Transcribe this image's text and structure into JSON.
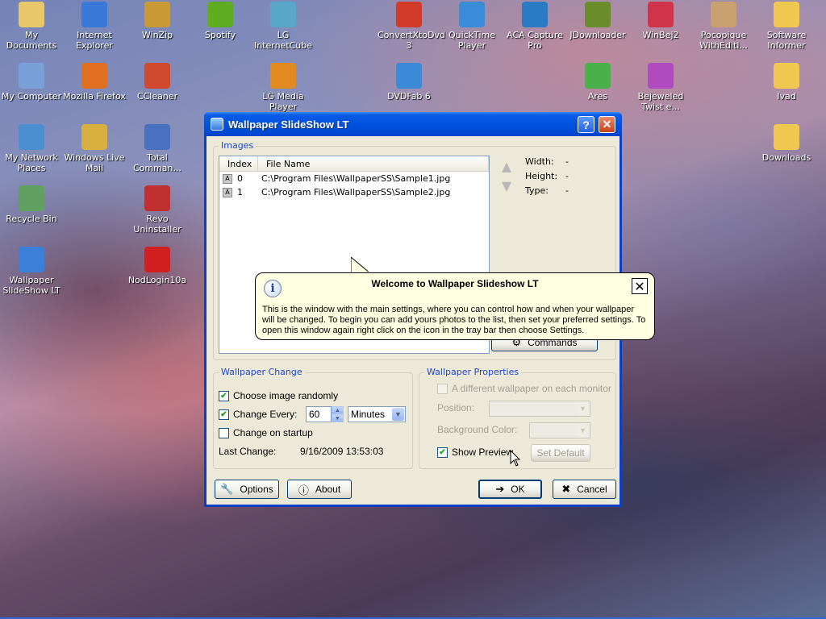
{
  "desktop_icons": [
    {
      "label": "My Documents",
      "color": "#e8c66a"
    },
    {
      "label": "Internet Explorer",
      "color": "#3b79d8"
    },
    {
      "label": "WinZip",
      "color": "#c79a35"
    },
    {
      "label": "Spotify",
      "color": "#5eac1f"
    },
    {
      "label": "LG InternetCube",
      "color": "#58a6c8"
    },
    {
      "label": "ConvertXtoDvd 3",
      "color": "#d23a2a"
    },
    {
      "label": "QuickTime Player",
      "color": "#3a8bd8"
    },
    {
      "label": "ACA Capture Pro",
      "color": "#2a7ac4"
    },
    {
      "label": "JDownloader",
      "color": "#6a8c2a"
    },
    {
      "label": "WinBej2",
      "color": "#d0344a"
    },
    {
      "label": "Pocopique WithEditi...",
      "color": "#c9a070"
    },
    {
      "label": "Software Informer",
      "color": "#f0c850"
    },
    {
      "label": "My Computer",
      "color": "#7aa0d8"
    },
    {
      "label": "Mozilla Firefox",
      "color": "#e07020"
    },
    {
      "label": "CCleaner",
      "color": "#d04a30"
    },
    {
      "label": "LG Media Player",
      "color": "#e08a20"
    },
    {
      "label": "DVDFab 6",
      "color": "#3a8ad8"
    },
    {
      "label": "Ares",
      "color": "#4ab04a"
    },
    {
      "label": "Bejeweled Twist e...",
      "color": "#b04ac0"
    },
    {
      "label": "Ivad",
      "color": "#f0c850"
    },
    {
      "label": "My Network Places",
      "color": "#4a90d0"
    },
    {
      "label": "Windows Live Mail",
      "color": "#d8b040"
    },
    {
      "label": "Total Comman...",
      "color": "#4a70c0"
    },
    {
      "label": "Downloads",
      "color": "#f0c850"
    },
    {
      "label": "Recycle Bin",
      "color": "#60a060"
    },
    {
      "label": "Revo Uninstaller",
      "color": "#c03030"
    },
    {
      "label": "Wallpaper SlideShow LT",
      "color": "#3a80d8"
    },
    {
      "label": "NodLogin10a",
      "color": "#d02020"
    }
  ],
  "window": {
    "title": "Wallpaper SlideShow LT",
    "help_glyph": "?",
    "close_glyph": "✕"
  },
  "images_group": {
    "label": "Images",
    "columns": [
      "Index",
      "File Name"
    ],
    "rows": [
      {
        "index": "0",
        "file": "C:\\Program Files\\WallpaperSS\\Sample1.jpg"
      },
      {
        "index": "1",
        "file": "C:\\Program Files\\WallpaperSS\\Sample2.jpg"
      }
    ],
    "width_label": "Width:",
    "width_value": "-",
    "height_label": "Height:",
    "height_value": "-",
    "type_label": "Type:",
    "type_value": "-",
    "commands_label": "Commands"
  },
  "wallpaper_change": {
    "label": "Wallpaper Change",
    "choose_randomly": "Choose image randomly",
    "change_every": "Change Every:",
    "interval_value": "60",
    "interval_unit": "Minutes",
    "change_on_startup": "Change on startup",
    "last_change_label": "Last Change:",
    "last_change_value": "9/16/2009 13:53:03"
  },
  "wallpaper_properties": {
    "label": "Wallpaper Properties",
    "different_each_monitor": "A different wallpaper on each monitor",
    "position_label": "Position:",
    "background_color_label": "Background Color:",
    "show_preview": "Show Preview",
    "set_default": "Set Default"
  },
  "footer": {
    "options": "Options",
    "about": "About",
    "ok": "OK",
    "cancel": "Cancel"
  },
  "balloon": {
    "title": "Welcome to Wallpaper Slideshow LT",
    "text": "This is the window with the main settings, where you can control how and when your wallpaper will be changed. To begin you can add  yours photos to the list, then set your preferred settings. To open this window again right click on the icon in the tray bar then choose Settings."
  }
}
